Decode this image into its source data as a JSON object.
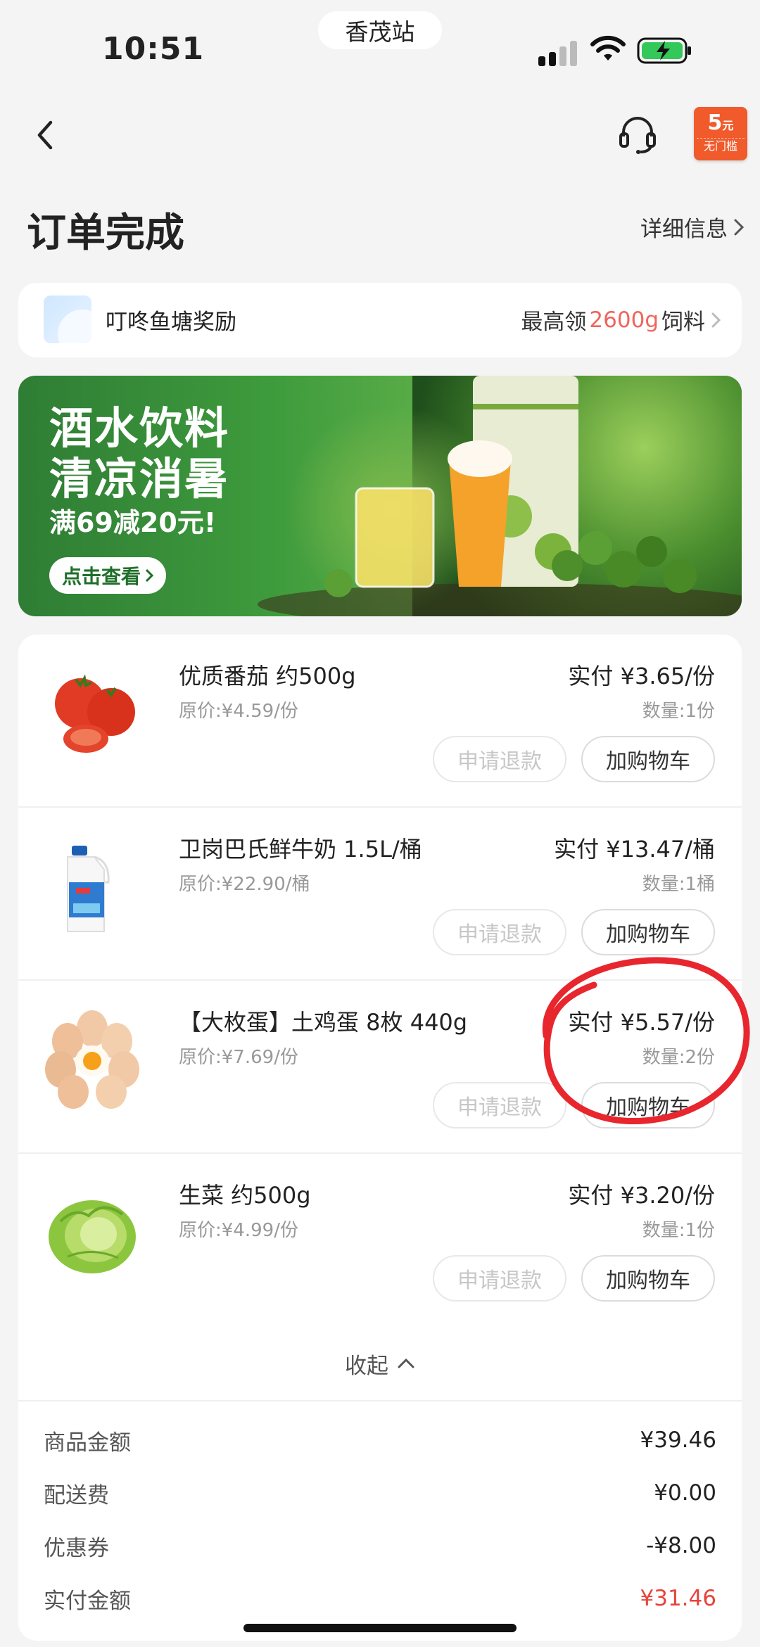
{
  "status_bar": {
    "time": "10:51",
    "station": "香茂站"
  },
  "nav": {
    "coupon_amount": "5",
    "coupon_unit": "元",
    "coupon_note": "无门槛"
  },
  "page_title": "订单完成",
  "detail_link": "详细信息",
  "reward": {
    "label": "叮咚鱼塘奖励",
    "prefix": "最高领",
    "amount": "2600g",
    "suffix": "饲料"
  },
  "banner": {
    "line1": "酒水饮料",
    "line2": "清凉消暑",
    "line3": "满69减20元!",
    "button": "点击查看"
  },
  "items": [
    {
      "name": "优质番茄 约500g",
      "orig": "原价:¥4.59/份",
      "paid": "实付 ¥3.65/份",
      "qty": "数量:1份",
      "refund": "申请退款",
      "cart": "加购物车"
    },
    {
      "name": "卫岗巴氏鲜牛奶 1.5L/桶",
      "orig": "原价:¥22.90/桶",
      "paid": "实付 ¥13.47/桶",
      "qty": "数量:1桶",
      "refund": "申请退款",
      "cart": "加购物车"
    },
    {
      "name": "【大枚蛋】土鸡蛋 8枚 440g",
      "orig": "原价:¥7.69/份",
      "paid": "实付 ¥5.57/份",
      "qty": "数量:2份",
      "refund": "申请退款",
      "cart": "加购物车"
    },
    {
      "name": "生菜 约500g",
      "orig": "原价:¥4.99/份",
      "paid": "实付 ¥3.20/份",
      "qty": "数量:1份",
      "refund": "申请退款",
      "cart": "加购物车"
    }
  ],
  "collapse_label": "收起",
  "summary": [
    {
      "label": "商品金额",
      "value": "¥39.46"
    },
    {
      "label": "配送费",
      "value": "¥0.00"
    },
    {
      "label": "优惠券",
      "value": "-¥8.00"
    },
    {
      "label": "实付金额",
      "value": "¥31.46"
    }
  ],
  "colors": {
    "accent_red": "#e8433b",
    "coupon_orange": "#f15a2b",
    "reward_highlight": "#f0655c",
    "annotation_red": "#e8262e"
  }
}
